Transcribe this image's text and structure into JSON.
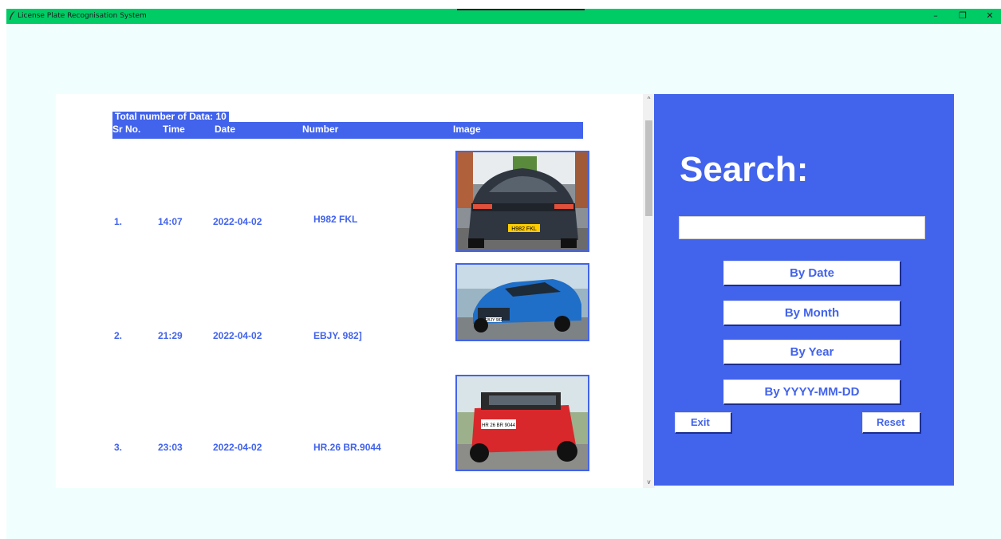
{
  "window": {
    "title": "License Plate Recognisation System",
    "controls": {
      "minimize": "–",
      "maximize": "❐",
      "close": "✕"
    }
  },
  "list": {
    "total_label": "Total number of Data: 10",
    "headers": {
      "sr": "Sr No.",
      "time": "Time",
      "date": "Date",
      "number": "Number",
      "image": "Image"
    },
    "rows": [
      {
        "sr": "1.",
        "time": "14:07",
        "date": "2022-04-02",
        "number": "H982 FKL",
        "image": "car-rear-dark-grey",
        "plate": "H982 FKL"
      },
      {
        "sr": "2.",
        "time": "21:29",
        "date": "2022-04-02",
        "number": "EBJY. 982]",
        "image": "car-front-blue-suv",
        "plate": "EBJY 982"
      },
      {
        "sr": "3.",
        "time": "23:03",
        "date": "2022-04-02",
        "number": "HR.26 BR.9044",
        "image": "car-rear-red-mini",
        "plate": "HR 26 BR 9044"
      }
    ]
  },
  "scrollbar": {
    "up": "^",
    "down": "v"
  },
  "search": {
    "title": "Search:",
    "input_value": "",
    "buttons": {
      "by_date": "By Date",
      "by_month": "By Month",
      "by_year": "By Year",
      "by_full": "By YYYY-MM-DD"
    },
    "exit": "Exit",
    "reset": "Reset"
  },
  "colors": {
    "titlebar": "#00cc66",
    "accent": "#4263eb",
    "background": "#f0fffd"
  }
}
